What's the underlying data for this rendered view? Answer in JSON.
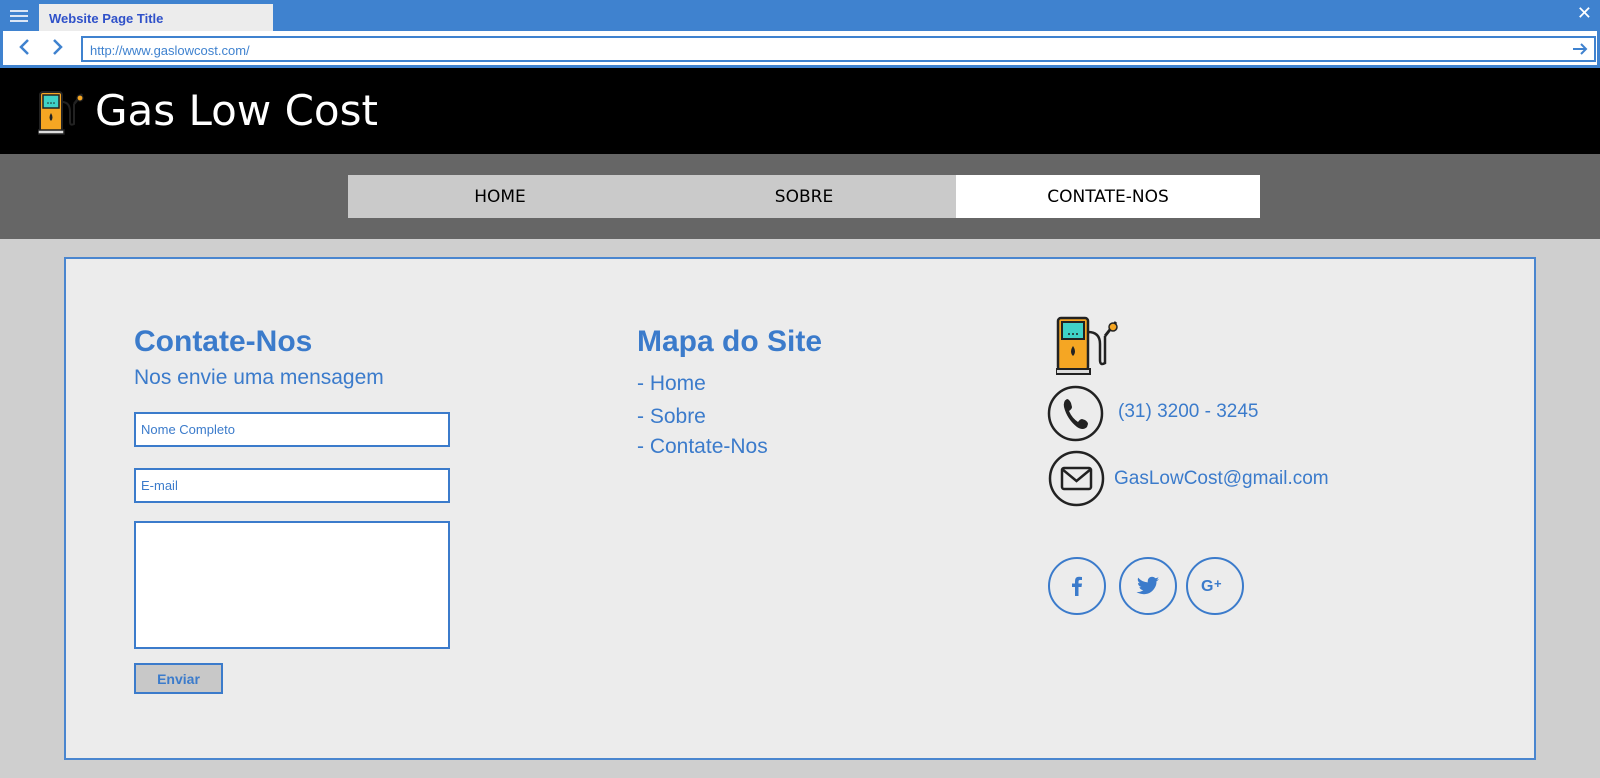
{
  "browser": {
    "tab_title": "Website Page Title",
    "url": "http://www.gaslowcost.com/"
  },
  "site": {
    "brand": "Gas Low Cost"
  },
  "menu": {
    "items": [
      {
        "label": "HOME"
      },
      {
        "label": "SOBRE"
      },
      {
        "label": "CONTATE-NOS"
      }
    ],
    "active": "CONTATE-NOS"
  },
  "contact": {
    "title": "Contate-Nos",
    "subtitle": "Nos envie uma mensagem",
    "name_placeholder": "Nome Completo",
    "email_placeholder": "E-mail",
    "message_placeholder": "",
    "send_label": "Enviar"
  },
  "sitemap": {
    "title": "Mapa do Site",
    "links": [
      "- Home",
      "- Sobre",
      "- Contate-Nos"
    ]
  },
  "info": {
    "phone": "(31) 3200 - 3245",
    "email": "GasLowCost@gmail.com",
    "social": [
      "facebook-icon",
      "twitter-icon",
      "google-plus-icon"
    ]
  },
  "colors": {
    "accent": "#3b7bcb",
    "chrome": "#3f82cf",
    "header_bg": "#000000",
    "menu_bg": "#666666"
  }
}
